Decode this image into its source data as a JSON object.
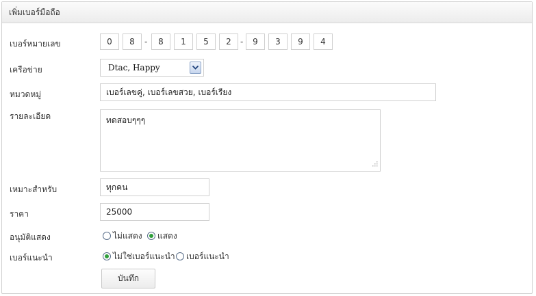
{
  "panel": {
    "title": "เพิ่มเบอร์มือถือ"
  },
  "form": {
    "phone": {
      "label": "เบอร์หมายเลข",
      "digits": [
        "0",
        "8",
        "8",
        "1",
        "5",
        "2",
        "9",
        "3",
        "9",
        "4"
      ],
      "separator": "-"
    },
    "network": {
      "label": "เครือข่าย",
      "selected": "Dtac, Happy"
    },
    "category": {
      "label": "หมวดหมู่",
      "value": "เบอร์เลขคู่, เบอร์เลขสวย, เบอร์เรียง"
    },
    "details": {
      "label": "รายละเอียด",
      "value": "ทดสอบๆๆๆ"
    },
    "suitable_for": {
      "label": "เหมาะสำหรับ",
      "value": "ทุกคน"
    },
    "price": {
      "label": "ราคา",
      "value": "25000"
    },
    "approve_display": {
      "label": "อนุมัติแสดง",
      "options": [
        {
          "label": "ไม่แสดง",
          "checked": false
        },
        {
          "label": "แสดง",
          "checked": true
        }
      ]
    },
    "recommended": {
      "label": "เบอร์แนะนำ",
      "options": [
        {
          "label": "ไม่ใช่เบอร์แนะนำ",
          "checked": true
        },
        {
          "label": "เบอร์แนะนำ",
          "checked": false
        }
      ]
    },
    "save_label": "บันทึก"
  },
  "icons": {
    "select_arrow": "chevron-down-icon",
    "resize_grip": "resize-grip-icon"
  },
  "colors": {
    "radio_checked": "#2f9e3a",
    "select_button": "#c7d6ee"
  }
}
